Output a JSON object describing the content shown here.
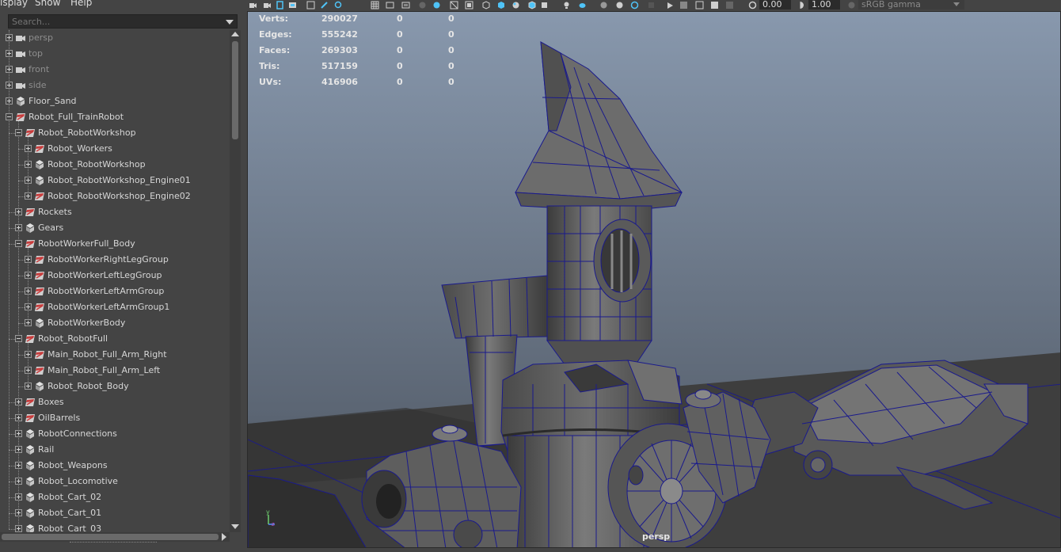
{
  "outliner": {
    "menu": [
      "isplay",
      "Show",
      "Help"
    ],
    "search_placeholder": "Search...",
    "items": [
      {
        "label": "persp",
        "depth": 0,
        "state": "plus",
        "icon": "camera-icon",
        "dim": true
      },
      {
        "label": "top",
        "depth": 0,
        "state": "plus",
        "icon": "camera-icon",
        "dim": true
      },
      {
        "label": "front",
        "depth": 0,
        "state": "plus",
        "icon": "camera-icon",
        "dim": true
      },
      {
        "label": "side",
        "depth": 0,
        "state": "plus",
        "icon": "camera-icon",
        "dim": true
      },
      {
        "label": "Floor_Sand",
        "depth": 0,
        "state": "plus",
        "icon": "transform-icon"
      },
      {
        "label": "Robot_Full_TrainRobot",
        "depth": 0,
        "state": "minus",
        "icon": "reference-icon"
      },
      {
        "label": "Robot_RobotWorkshop",
        "depth": 1,
        "state": "minus",
        "icon": "reference-icon"
      },
      {
        "label": "Robot_Workers",
        "depth": 2,
        "state": "plus",
        "icon": "reference-icon"
      },
      {
        "label": "Robot_RobotWorkshop",
        "depth": 2,
        "state": "plus",
        "icon": "transform-icon"
      },
      {
        "label": "Robot_RobotWorkshop_Engine01",
        "depth": 2,
        "state": "plus",
        "icon": "transform-icon"
      },
      {
        "label": "Robot_RobotWorkshop_Engine02",
        "depth": 2,
        "state": "plus",
        "icon": "reference-icon"
      },
      {
        "label": "Rockets",
        "depth": 1,
        "state": "plus",
        "icon": "reference-icon"
      },
      {
        "label": "Gears",
        "depth": 1,
        "state": "plus",
        "icon": "transform-icon"
      },
      {
        "label": "RobotWorkerFull_Body",
        "depth": 1,
        "state": "minus",
        "icon": "reference-icon"
      },
      {
        "label": "RobotWorkerRightLegGroup",
        "depth": 2,
        "state": "plus",
        "icon": "reference-icon"
      },
      {
        "label": "RobotWorkerLeftLegGroup",
        "depth": 2,
        "state": "plus",
        "icon": "reference-icon"
      },
      {
        "label": "RobotWorkerLeftArmGroup",
        "depth": 2,
        "state": "plus",
        "icon": "reference-icon"
      },
      {
        "label": "RobotWorkerLeftArmGroup1",
        "depth": 2,
        "state": "plus",
        "icon": "reference-icon"
      },
      {
        "label": "RobotWorkerBody",
        "depth": 2,
        "state": "plus",
        "icon": "transform-icon"
      },
      {
        "label": "Robot_RobotFull",
        "depth": 1,
        "state": "minus",
        "icon": "reference-icon"
      },
      {
        "label": "Main_Robot_Full_Arm_Right",
        "depth": 2,
        "state": "plus",
        "icon": "reference-icon"
      },
      {
        "label": "Main_Robot_Full_Arm_Left",
        "depth": 2,
        "state": "plus",
        "icon": "reference-icon"
      },
      {
        "label": "Robot_Robot_Body",
        "depth": 2,
        "state": "plus",
        "icon": "transform-icon"
      },
      {
        "label": "Boxes",
        "depth": 1,
        "state": "plus",
        "icon": "reference-icon"
      },
      {
        "label": "OilBarrels",
        "depth": 1,
        "state": "plus",
        "icon": "reference-icon"
      },
      {
        "label": "RobotConnections",
        "depth": 1,
        "state": "plus",
        "icon": "transform-icon"
      },
      {
        "label": "Rail",
        "depth": 1,
        "state": "plus",
        "icon": "transform-icon"
      },
      {
        "label": "Robot_Weapons",
        "depth": 1,
        "state": "plus",
        "icon": "transform-icon"
      },
      {
        "label": "Robot_Locomotive",
        "depth": 1,
        "state": "plus",
        "icon": "transform-icon"
      },
      {
        "label": "Robot_Cart_02",
        "depth": 1,
        "state": "plus",
        "icon": "transform-icon"
      },
      {
        "label": "Robot_Cart_01",
        "depth": 1,
        "state": "plus",
        "icon": "transform-icon"
      },
      {
        "label": "Robot_Cart_03",
        "depth": 1,
        "state": "plus",
        "icon": "transform-icon"
      }
    ]
  },
  "toolbar": {
    "exposure": "0.00",
    "gamma": "1.00",
    "color_space": "sRGB gamma"
  },
  "hud": {
    "rows": [
      {
        "label": "Verts:",
        "total": "290027",
        "selected": "0",
        "component": "0"
      },
      {
        "label": "Edges:",
        "total": "555242",
        "selected": "0",
        "component": "0"
      },
      {
        "label": "Faces:",
        "total": "269303",
        "selected": "0",
        "component": "0"
      },
      {
        "label": "Tris:",
        "total": "517159",
        "selected": "0",
        "component": "0"
      },
      {
        "label": "UVs:",
        "total": "416906",
        "selected": "0",
        "component": "0"
      }
    ]
  },
  "viewport": {
    "camera": "persp",
    "axis_y": "y",
    "axis_z": "z"
  },
  "colors": {
    "panel": "#444444",
    "viewport_top": "#8898ad",
    "viewport_bottom": "#3a3f47",
    "wire": "#1a1a8c",
    "mesh": "#6a6a6a"
  }
}
